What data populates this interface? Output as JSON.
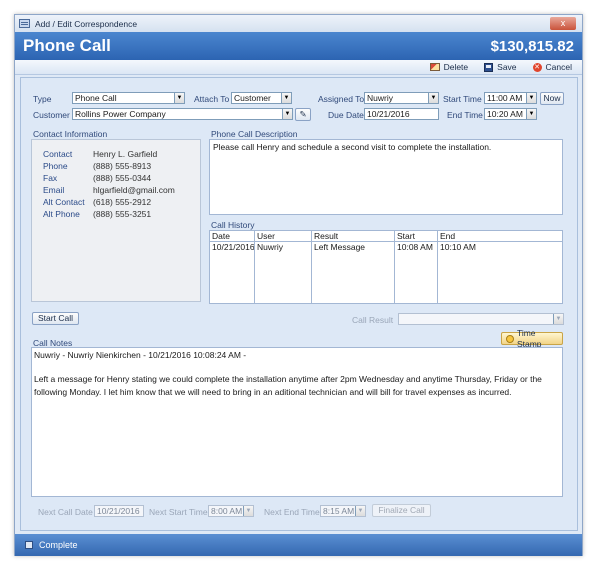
{
  "window": {
    "title": "Add / Edit Correspondence",
    "close_glyph": "x"
  },
  "header": {
    "title": "Phone Call",
    "amount": "$130,815.82"
  },
  "toolbar": {
    "delete": "Delete",
    "save": "Save",
    "cancel": "Cancel"
  },
  "form": {
    "type_label": "Type",
    "type_value": "Phone Call",
    "attach_label": "Attach To",
    "attach_value": "Customer",
    "assigned_label": "Assigned To",
    "assigned_value": "Nuwriy",
    "start_time_label": "Start Time",
    "start_time_value": "11:00 AM",
    "now_button": "Now",
    "customer_label": "Customer",
    "customer_value": "Rollins Power Company",
    "due_date_label": "Due Date",
    "due_date_value": "10/21/2016",
    "end_time_label": "End Time",
    "end_time_value": "10:20 AM"
  },
  "contact": {
    "section_title": "Contact Information",
    "rows": [
      {
        "label": "Contact",
        "value": "Henry L. Garfield"
      },
      {
        "label": "Phone",
        "value": "(888) 555-8913"
      },
      {
        "label": "Fax",
        "value": "(888) 555-0344"
      },
      {
        "label": "Email",
        "value": "hlgarfield@gmail.com"
      },
      {
        "label": "Alt Contact",
        "value": "(618) 555-2912"
      },
      {
        "label": "Alt Phone",
        "value": "(888) 555-3251"
      }
    ]
  },
  "description": {
    "section_title": "Phone Call Description",
    "text": "Please call Henry and schedule a second visit to complete the installation."
  },
  "history": {
    "section_title": "Call History",
    "columns": [
      "Date",
      "User",
      "Result",
      "Start",
      "End"
    ],
    "rows": [
      [
        "10/21/2016",
        "Nuwriy",
        "Left Message",
        "10:08 AM",
        "10:10 AM"
      ]
    ]
  },
  "call": {
    "start_button": "Start Call",
    "result_label": "Call Result",
    "result_value": ""
  },
  "notes": {
    "section_title": "Call Notes",
    "timestamp_button": "Time Stamp",
    "line1": "Nuwriy - Nuwriy Nienkirchen - 10/21/2016 10:08:24 AM -",
    "line2": "Left a message for Henry stating we could complete the installation anytime after 2pm Wednesday and anytime Thursday, Friday or the following Monday. I let him know that we will need to bring in an aditional technician and will bill for travel expenses as incurred."
  },
  "next": {
    "date_label": "Next Call Date",
    "date_value": "10/21/2016",
    "start_label": "Next Start Time",
    "start_value": "8:00 AM",
    "end_label": "Next End Time",
    "end_value": "8:15 AM",
    "finalize_button": "Finalize Call"
  },
  "status": {
    "complete_label": "Complete"
  },
  "colors": {
    "header_blue": "#2c64b2",
    "panel_bg": "#dde8f6",
    "label_blue": "#30497a"
  }
}
